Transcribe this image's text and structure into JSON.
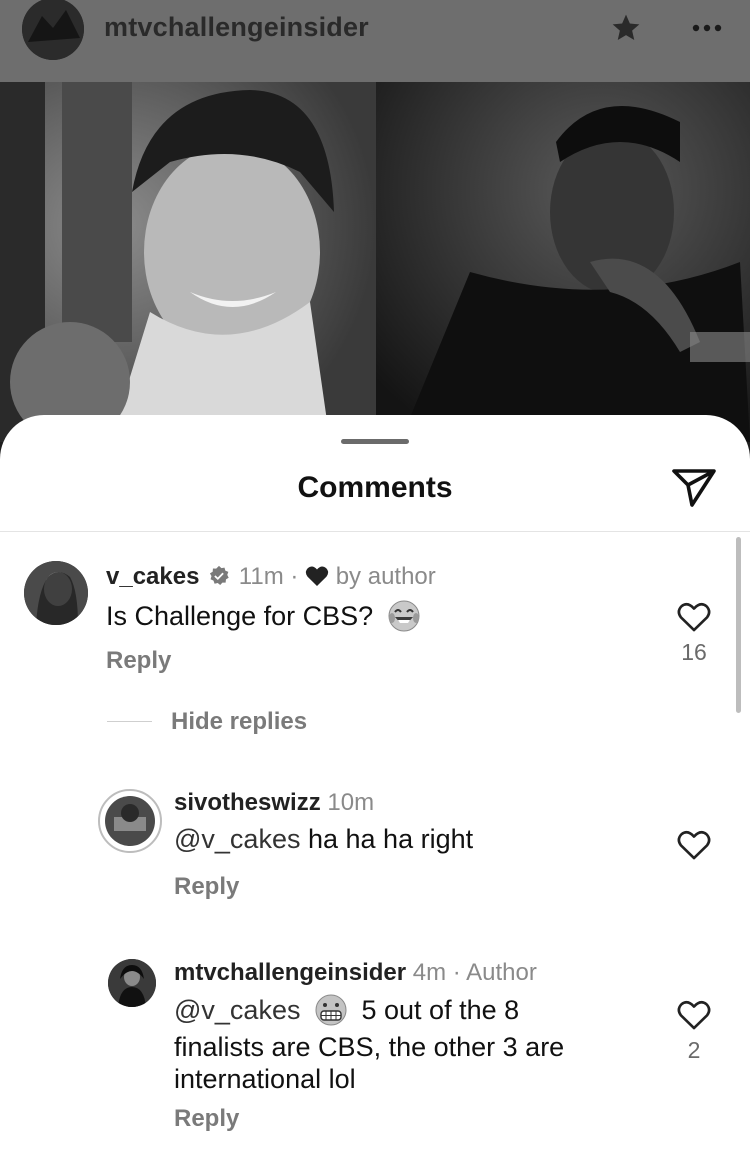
{
  "post": {
    "username": "mtvchallengeinsider"
  },
  "icons": {
    "star": "star-icon",
    "more": "more-icon",
    "send": "send-icon",
    "heart": "heart-icon",
    "verified": "verified-badge-icon",
    "emoji_laugh": "tears-of-joy-emoji",
    "emoji_grimace": "grimacing-emoji"
  },
  "sheet": {
    "title": "Comments"
  },
  "comments": [
    {
      "username": "v_cakes",
      "time": "11m",
      "sep": "·",
      "liked_label": "by author",
      "text": "Is Challenge for CBS?",
      "reply_label": "Reply",
      "likes": "16"
    },
    {
      "username": "sivotheswizz",
      "time": "10m",
      "mention": "@v_cakes",
      "text": "ha ha ha right",
      "reply_label": "Reply"
    },
    {
      "username": "mtvchallengeinsider",
      "time": "4m",
      "sep": "·",
      "tag": "Author",
      "mention": "@v_cakes",
      "text_line1": "5 out of the 8",
      "text_line2": "finalists are CBS, the other 3 are",
      "text_line3": "international lol",
      "reply_label": "Reply",
      "likes": "2"
    }
  ],
  "thread": {
    "hide_replies_label": "Hide replies"
  }
}
